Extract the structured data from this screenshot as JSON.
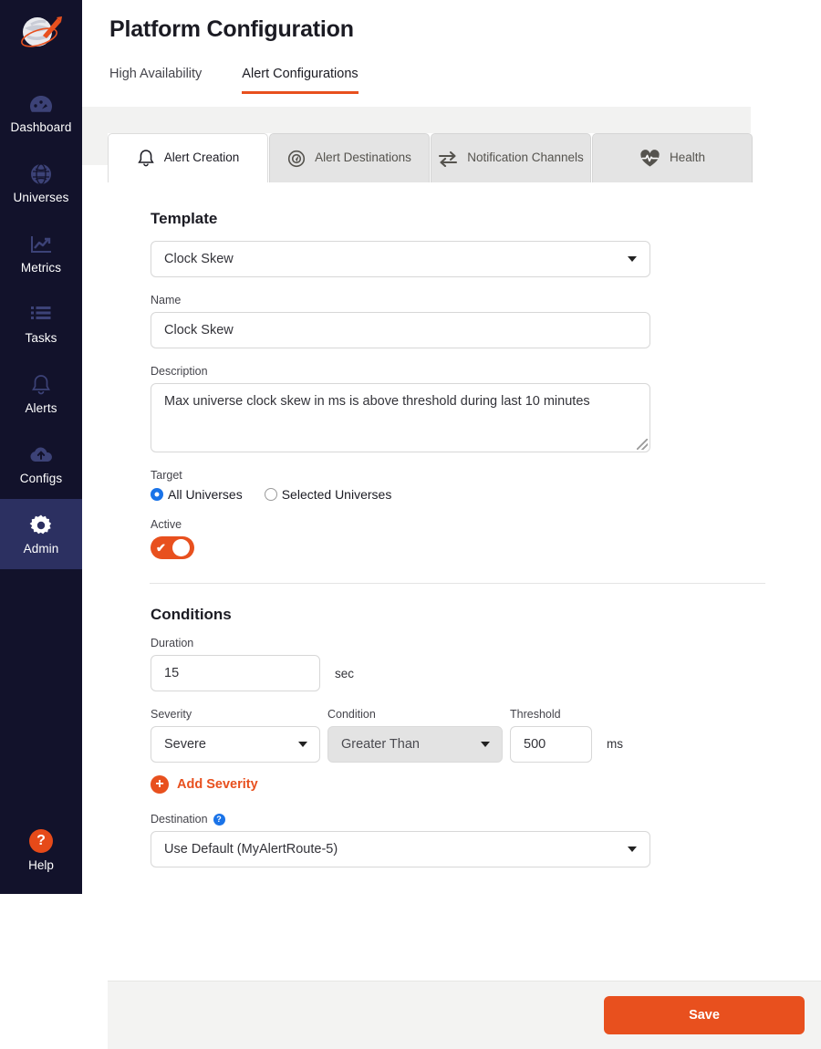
{
  "sidebar": {
    "logo_name": "yugabyte-rocket-logo",
    "items": [
      {
        "label": "Dashboard",
        "icon": "dashboard-icon",
        "active": false
      },
      {
        "label": "Universes",
        "icon": "globe-icon",
        "active": false
      },
      {
        "label": "Metrics",
        "icon": "chart-line-icon",
        "active": false
      },
      {
        "label": "Tasks",
        "icon": "list-icon",
        "active": false
      },
      {
        "label": "Alerts",
        "icon": "bell-icon",
        "active": false
      },
      {
        "label": "Configs",
        "icon": "cloud-upload-icon",
        "active": false
      },
      {
        "label": "Admin",
        "icon": "gear-icon",
        "active": true
      }
    ],
    "help": {
      "label": "Help",
      "glyph": "?"
    }
  },
  "header": {
    "title": "Platform Configuration",
    "tabs": [
      {
        "label": "High Availability",
        "active": false
      },
      {
        "label": "Alert Configurations",
        "active": true
      }
    ]
  },
  "subtabs": [
    {
      "label": "Alert Creation",
      "icon": "bell-icon",
      "active": true
    },
    {
      "label": "Alert Destinations",
      "icon": "compass-icon",
      "active": false
    },
    {
      "label": "Notification Channels",
      "icon": "exchange-arrows-icon",
      "active": false
    },
    {
      "label": "Health",
      "icon": "heartbeat-icon",
      "active": false
    }
  ],
  "form": {
    "template_section_title": "Template",
    "template": {
      "label": "Template",
      "value": "Clock Skew"
    },
    "name": {
      "label": "Name",
      "value": "Clock Skew"
    },
    "description": {
      "label": "Description",
      "value": "Max universe clock skew in ms is above threshold during last 10 minutes"
    },
    "target": {
      "label": "Target",
      "options": [
        {
          "label": "All Universes",
          "checked": true
        },
        {
          "label": "Selected Universes",
          "checked": false
        }
      ]
    },
    "active": {
      "label": "Active",
      "on": true,
      "check_glyph": "✔"
    }
  },
  "conditions": {
    "section_title": "Conditions",
    "duration": {
      "label": "Duration",
      "value": "15",
      "unit": "sec"
    },
    "severity": {
      "label": "Severity",
      "value": "Severe"
    },
    "condition": {
      "label": "Condition",
      "value": "Greater Than",
      "disabled": true
    },
    "threshold": {
      "label": "Threshold",
      "value": "500",
      "unit": "ms"
    },
    "add_severity": {
      "label": "Add Severity",
      "glyph": "+"
    },
    "destination": {
      "label": "Destination",
      "help_glyph": "?",
      "value": "Use Default (MyAlertRoute-5)"
    }
  },
  "footer": {
    "save_label": "Save"
  },
  "colors": {
    "sidebar_bg": "#12122b",
    "sidebar_active": "#2c3061",
    "accent": "#e8501e",
    "radio_blue": "#1a73e8",
    "tabstrip_bg": "#f2f2f1",
    "footer_bg": "#f3f3f2"
  }
}
